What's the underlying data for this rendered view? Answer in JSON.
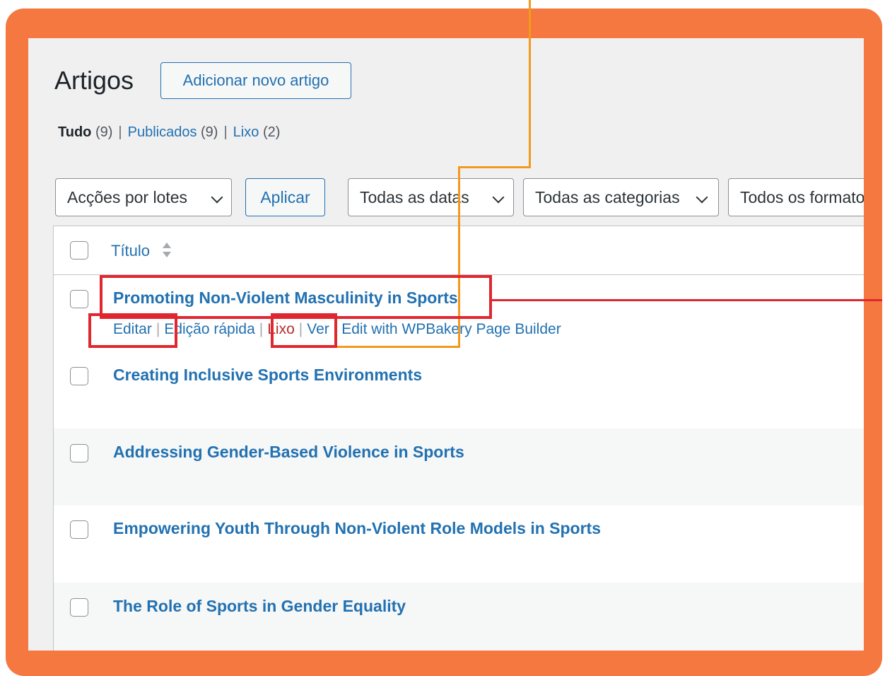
{
  "header": {
    "title": "Artigos",
    "add_new_label": "Adicionar novo artigo"
  },
  "filters": {
    "all_label": "Tudo",
    "all_count": "(9)",
    "published_label": "Publicados",
    "published_count": "(9)",
    "trash_label": "Lixo",
    "trash_count": "(2)",
    "separator": "|"
  },
  "toolbar": {
    "bulk_actions": "Acções por lotes",
    "apply_label": "Aplicar",
    "dates": "Todas as datas",
    "categories": "Todas as categorias",
    "formats": "Todos os formatos"
  },
  "table": {
    "column_title": "Título",
    "rows": [
      {
        "title": "Promoting Non-Violent Masculinity in Sports",
        "actions": {
          "edit": "Editar",
          "quick_edit": "Edição rápida",
          "trash": "Lixo",
          "view": "Ver",
          "wpbakery": "Edit with WPBakery Page Builder",
          "separator": "|"
        }
      },
      {
        "title": "Creating Inclusive Sports Environments"
      },
      {
        "title": "Addressing Gender-Based Violence in Sports"
      },
      {
        "title": "Empowering Youth Through Non-Violent Role Models in Sports"
      },
      {
        "title": "The Role of Sports in Gender Equality"
      }
    ]
  },
  "icons": {
    "sort": "sort-icon",
    "chevron": "chevron-down-icon"
  },
  "colors": {
    "frame": "#f47840",
    "link": "#2271b1",
    "trash": "#b32d2e",
    "highlight": "#e0262f",
    "connector": "#f39a1d"
  }
}
